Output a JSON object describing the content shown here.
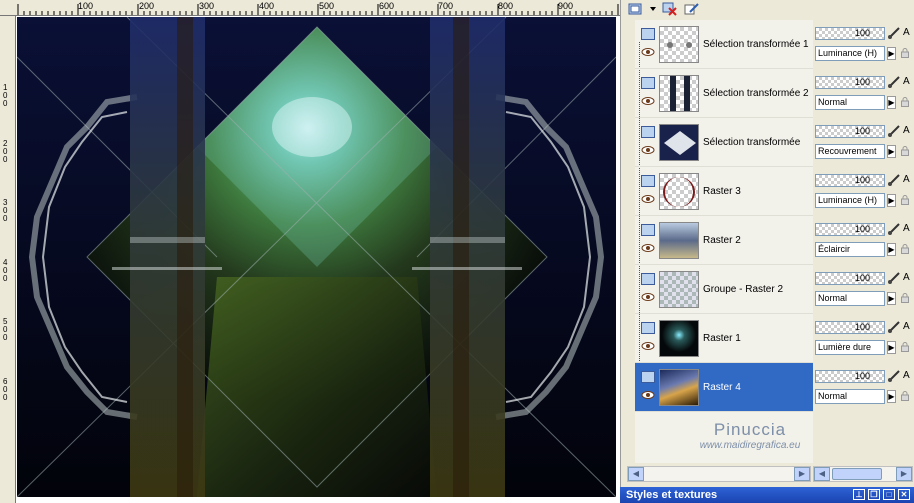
{
  "ruler": {
    "horizontal_labels": [
      "100",
      "200",
      "300",
      "400",
      "500",
      "600",
      "700",
      "800",
      "900"
    ],
    "vertical_labels": [
      "1\n0\n0",
      "2\n0\n0",
      "3\n0\n0",
      "4\n0\n0",
      "5\n0\n0",
      "6\n0\n0"
    ]
  },
  "toolbar": {
    "icons": [
      "new-layer-icon",
      "delete-layer-icon",
      "edit-icon"
    ]
  },
  "layers": [
    {
      "name": "Sélection transformée 1",
      "opacity": "100",
      "blend": "Luminance (H)",
      "selected": false
    },
    {
      "name": "Sélection transformée 2",
      "opacity": "100",
      "blend": "Normal",
      "selected": false
    },
    {
      "name": "Sélection transformée",
      "opacity": "100",
      "blend": "Recouvrement",
      "selected": false
    },
    {
      "name": "Raster 3",
      "opacity": "100",
      "blend": "Luminance (H)",
      "selected": false
    },
    {
      "name": "Raster 2",
      "opacity": "100",
      "blend": "Éclaircir",
      "selected": false
    },
    {
      "name": "Groupe - Raster 2",
      "opacity": "100",
      "blend": "Normal",
      "selected": false
    },
    {
      "name": "Raster 1",
      "opacity": "100",
      "blend": "Lumière dure",
      "selected": false
    },
    {
      "name": "Raster 4",
      "opacity": "100",
      "blend": "Normal",
      "selected": true
    }
  ],
  "prop_letter": "A",
  "watermark": {
    "line1": "Pinuccia",
    "line2": "www.maidiregrafica.eu"
  },
  "styles_panel": {
    "title": "Styles et textures"
  },
  "colors": {
    "selection": "#316ac5",
    "palette_bg": "#ece9d8",
    "title_bar": "#2155c9"
  }
}
